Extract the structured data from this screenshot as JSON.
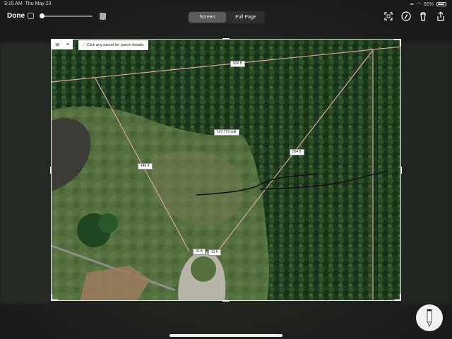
{
  "status_bar": {
    "time": "9:15 AM",
    "date": "Thu May 23",
    "battery": "91%"
  },
  "toolbar": {
    "done_label": "Done",
    "segments": [
      {
        "label": "Screen",
        "active": true
      },
      {
        "label": "Full Page",
        "active": false
      }
    ],
    "icons": [
      "crop-icon",
      "markup-icon",
      "trash-icon",
      "share-icon"
    ]
  },
  "map": {
    "notice": "Click any parcel for parcel details.",
    "tool_icons": [
      "layers-icon",
      "locate-icon"
    ],
    "measurements": {
      "top": "926 ft",
      "area": "147,772 sqft",
      "left": "446 ft",
      "right": "584 ft",
      "bottom_left": "31 ft",
      "bottom_right": "31 ft"
    },
    "colors": {
      "parcel_line": "#d9a3a3",
      "forest": "#1f3a1d",
      "field": "#4e6b3a"
    }
  },
  "pen": {
    "icon": "pencil-icon"
  }
}
